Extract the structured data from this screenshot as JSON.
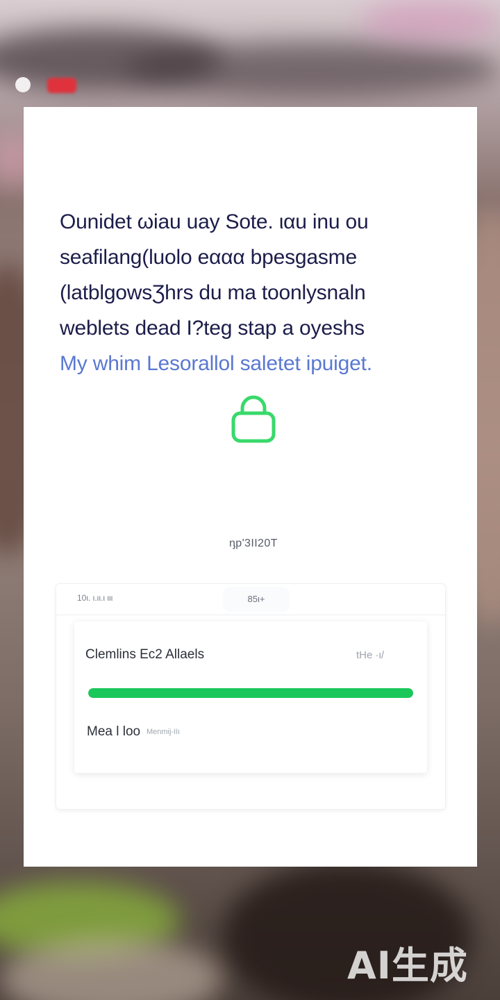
{
  "status_bar": {
    "indicator_color": "#e0323c"
  },
  "dialog": {
    "message_lines": [
      "Ounidet ωiau uay Sote. ιαu  inu ou",
      "seafilang(luolo eααα bpesgasme",
      "(latblgowsƷhrs du ma toonlysnaln",
      "weblets dead Ι?teg stap a oyeshs"
    ],
    "link_text": "My whim Lesorallol saletet ipuiget.",
    "lock_icon_color": "#39d96b",
    "caption": "ᶇp'3ΙΙ20T"
  },
  "download_panel": {
    "tab_left_label": "10ι. ι.ιι.ι ιιι",
    "tab_right_label": "85ι+",
    "item": {
      "name": "Clemlins Ec2  Allaels",
      "size": "tHe ·ι/",
      "progress": 1.0,
      "progress_color": "#19c75a",
      "status": "Mea l loo",
      "status_sub": "Menmij-ΙΙι"
    }
  },
  "watermark": "AI生成"
}
